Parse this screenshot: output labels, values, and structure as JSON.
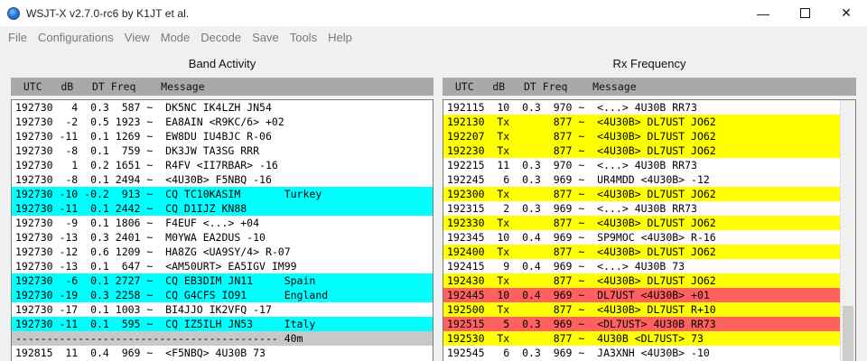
{
  "window": {
    "title": "WSJT-X   v2.7.0-rc6   by K1JT et al.",
    "minimize_glyph": "—",
    "close_glyph": "✕"
  },
  "menu": {
    "items": [
      "File",
      "Configurations",
      "View",
      "Mode",
      "Decode",
      "Save",
      "Tools",
      "Help"
    ]
  },
  "band_activity": {
    "title": "Band Activity",
    "header": "  UTC   dB   DT Freq    Message",
    "rows": [
      {
        "text": "192730   4  0.3  587 ~  DK5NC IK4LZH JN54",
        "hl": ""
      },
      {
        "text": "192730  -2  0.5 1923 ~  EA8AIN <R9KC/6> +02",
        "hl": ""
      },
      {
        "text": "192730 -11  0.1 1269 ~  EW8DU IU4BJC R-06",
        "hl": ""
      },
      {
        "text": "192730  -8  0.1  759 ~  DK3JW TA3SG RRR",
        "hl": ""
      },
      {
        "text": "192730   1  0.2 1651 ~  R4FV <II7RBAR> -16",
        "hl": ""
      },
      {
        "text": "192730  -8  0.1 2494 ~  <4U30B> F5NBQ -16",
        "hl": ""
      },
      {
        "text": "192730 -10 -0.2  913 ~  CQ TC10KASIM       Turkey",
        "hl": "cyan"
      },
      {
        "text": "192730 -11  0.1 2442 ~  CQ D1IJZ KN88",
        "hl": "cyan"
      },
      {
        "text": "192730  -9  0.1 1806 ~  F4EUF <...> +04",
        "hl": ""
      },
      {
        "text": "192730 -13  0.3 2401 ~  M0YWA EA2DUS -10",
        "hl": ""
      },
      {
        "text": "192730 -12  0.6 1209 ~  HA8ZG <UA9SY/4> R-07",
        "hl": ""
      },
      {
        "text": "192730 -13  0.1  647 ~  <AM50URT> EA5IGV IM99",
        "hl": ""
      },
      {
        "text": "192730  -6  0.1 2727 ~  CQ EB3DIM JN11     Spain",
        "hl": "cyan"
      },
      {
        "text": "192730 -19  0.3 2258 ~  CQ G4CFS IO91      England",
        "hl": "cyan"
      },
      {
        "text": "192730 -17  0.1 1003 ~  BI4JJO IK2VFQ -17",
        "hl": ""
      },
      {
        "text": "192730 -11  0.1  595 ~  CQ IZ5ILH JN53     Italy",
        "hl": "cyan"
      },
      {
        "text": "------------------------------------------ 40m",
        "hl": "sep"
      },
      {
        "text": "192815  11  0.4  969 ~  <F5NBQ> 4U30B 73",
        "hl": ""
      }
    ]
  },
  "rx_frequency": {
    "title": "Rx Frequency",
    "header": "  UTC   dB   DT Freq    Message",
    "rows": [
      {
        "text": "192115  10  0.3  970 ~  <...> 4U30B RR73",
        "hl": ""
      },
      {
        "text": "192130  Tx       877 ~  <4U30B> DL7UST JO62",
        "hl": "yellow"
      },
      {
        "text": "192207  Tx       877 ~  <4U30B> DL7UST JO62",
        "hl": "yellow"
      },
      {
        "text": "192230  Tx       877 ~  <4U30B> DL7UST JO62",
        "hl": "yellow"
      },
      {
        "text": "192215  11  0.3  970 ~  <...> 4U30B RR73",
        "hl": ""
      },
      {
        "text": "192245   6  0.3  969 ~  UR4MDD <4U30B> -12",
        "hl": ""
      },
      {
        "text": "192300  Tx       877 ~  <4U30B> DL7UST JO62",
        "hl": "yellow"
      },
      {
        "text": "192315   2  0.3  969 ~  <...> 4U30B RR73",
        "hl": ""
      },
      {
        "text": "192330  Tx       877 ~  <4U30B> DL7UST JO62",
        "hl": "yellow"
      },
      {
        "text": "192345  10  0.4  969 ~  SP9MOC <4U30B> R-16",
        "hl": ""
      },
      {
        "text": "192400  Tx       877 ~  <4U30B> DL7UST JO62",
        "hl": "yellow"
      },
      {
        "text": "192415   9  0.4  969 ~  <...> 4U30B 73",
        "hl": ""
      },
      {
        "text": "192430  Tx       877 ~  <4U30B> DL7UST JO62",
        "hl": "yellow"
      },
      {
        "text": "192445  10  0.4  969 ~  DL7UST <4U30B> +01",
        "hl": "red"
      },
      {
        "text": "192500  Tx       877 ~  <4U30B> DL7UST R+10",
        "hl": "yellow"
      },
      {
        "text": "192515   5  0.3  969 ~  <DL7UST> 4U30B RR73",
        "hl": "red"
      },
      {
        "text": "192530  Tx       877 ~  4U30B <DL7UST> 73",
        "hl": "yellow"
      },
      {
        "text": "192545   6  0.3  969 ~  JA3XNH <4U30B> -10",
        "hl": ""
      }
    ]
  },
  "colors": {
    "cq_highlight": "#00ffff",
    "tx_highlight": "#ffff00",
    "to_me_highlight": "#ff6060",
    "separator": "#c8c8c8",
    "header_bg": "#a9a9a9"
  },
  "icons": {
    "app": "wsjtx-globe-icon",
    "minimize": "minimize-icon",
    "maximize": "maximize-icon",
    "close": "close-icon"
  }
}
